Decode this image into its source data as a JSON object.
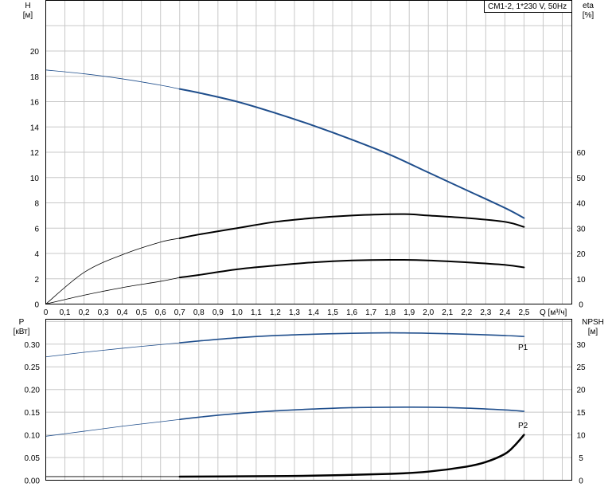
{
  "chart_data": [
    {
      "type": "line",
      "panel": "head",
      "title": "CM1-2, 1*230 V, 50Hz",
      "xlabel": "Q [м³/ч]",
      "x_ticks": [
        "0",
        "0,1",
        "0,2",
        "0,3",
        "0,4",
        "0,5",
        "0,6",
        "0,7",
        "0,8",
        "0,9",
        "1,0",
        "1,1",
        "1,2",
        "1,3",
        "1,4",
        "1,5",
        "1,6",
        "1,7",
        "1,8",
        "1,9",
        "2,0",
        "2,1",
        "2,2",
        "2,3",
        "2,4",
        "2,5"
      ],
      "xlim": [
        0,
        2.75
      ],
      "ylabel_left": "H",
      "ylabel_left_unit": "[м]",
      "ylim_left": [
        0,
        24
      ],
      "y_ticks_left": [
        "0",
        "2",
        "4",
        "6",
        "8",
        "10",
        "12",
        "14",
        "16",
        "18",
        "20"
      ],
      "ylabel_right": "eta",
      "ylabel_right_unit": "[%]",
      "ylim_right": [
        0,
        120
      ],
      "y_ticks_right": [
        "0",
        "10",
        "20",
        "30",
        "40",
        "50",
        "60"
      ],
      "grid": true,
      "series": [
        {
          "axis": "left",
          "color": "#1f4e8c",
          "operating_range": [
            0.7,
            2.5
          ],
          "x": [
            0,
            0.2,
            0.4,
            0.6,
            0.7,
            0.8,
            1.0,
            1.2,
            1.4,
            1.6,
            1.8,
            2.0,
            2.2,
            2.4,
            2.5
          ],
          "y": [
            18.5,
            18.2,
            17.8,
            17.3,
            17.0,
            16.7,
            16.0,
            15.1,
            14.1,
            13.0,
            11.8,
            10.4,
            9.0,
            7.6,
            6.8
          ]
        },
        {
          "axis": "right",
          "color": "#000000",
          "operating_range": [
            0.7,
            2.5
          ],
          "x": [
            0,
            0.2,
            0.4,
            0.6,
            0.7,
            0.8,
            1.0,
            1.2,
            1.4,
            1.6,
            1.8,
            1.9,
            2.0,
            2.2,
            2.4,
            2.5
          ],
          "y": [
            0,
            12.5,
            19.5,
            24.5,
            26.0,
            27.5,
            30.0,
            32.5,
            34.0,
            35.0,
            35.5,
            35.5,
            35.0,
            34.0,
            32.5,
            30.5
          ]
        },
        {
          "axis": "left",
          "color": "#000000",
          "operating_range": [
            0.7,
            2.5
          ],
          "x": [
            0,
            0.2,
            0.4,
            0.6,
            0.7,
            0.8,
            1.0,
            1.2,
            1.4,
            1.6,
            1.8,
            2.0,
            2.2,
            2.4,
            2.5
          ],
          "y": [
            0,
            0.7,
            1.3,
            1.8,
            2.1,
            2.3,
            2.75,
            3.05,
            3.3,
            3.45,
            3.5,
            3.45,
            3.3,
            3.1,
            2.9
          ]
        }
      ]
    },
    {
      "type": "line",
      "panel": "power",
      "ylabel_left": "P",
      "ylabel_left_unit": "[кВт]",
      "ylim_left": [
        0,
        0.355
      ],
      "y_ticks_left": [
        "0.00",
        "0.05",
        "0.10",
        "0.15",
        "0.20",
        "0.25",
        "0.30"
      ],
      "ylabel_right": "NPSH",
      "ylabel_right_unit": "[м]",
      "ylim_right": [
        0,
        35.5
      ],
      "y_ticks_right": [
        "0",
        "5",
        "10",
        "15",
        "20",
        "25",
        "30"
      ],
      "xlim": [
        0,
        2.75
      ],
      "grid": true,
      "series": [
        {
          "name": "P1",
          "axis": "left",
          "color": "#1f4e8c",
          "operating_range": [
            0.7,
            2.5
          ],
          "x": [
            0,
            0.2,
            0.4,
            0.6,
            0.7,
            0.8,
            1.0,
            1.2,
            1.4,
            1.6,
            1.8,
            2.0,
            2.2,
            2.4,
            2.5
          ],
          "y": [
            0.272,
            0.282,
            0.291,
            0.299,
            0.303,
            0.307,
            0.314,
            0.319,
            0.322,
            0.324,
            0.325,
            0.324,
            0.322,
            0.319,
            0.317
          ]
        },
        {
          "name": "P2",
          "axis": "left",
          "color": "#1f4e8c",
          "operating_range": [
            0.7,
            2.5
          ],
          "x": [
            0,
            0.2,
            0.4,
            0.6,
            0.7,
            0.8,
            1.0,
            1.2,
            1.4,
            1.6,
            1.8,
            2.0,
            2.2,
            2.4,
            2.5
          ],
          "y": [
            0.097,
            0.108,
            0.119,
            0.129,
            0.134,
            0.139,
            0.147,
            0.153,
            0.157,
            0.16,
            0.161,
            0.161,
            0.159,
            0.155,
            0.152
          ]
        },
        {
          "axis": "right",
          "color": "#000000",
          "operating_range": [
            0.7,
            2.5
          ],
          "x": [
            0,
            0.7,
            1.0,
            1.4,
            1.8,
            2.0,
            2.2,
            2.3,
            2.4,
            2.45,
            2.5
          ],
          "y": [
            0.8,
            0.8,
            0.85,
            1.0,
            1.4,
            1.9,
            3.0,
            4.0,
            5.8,
            7.6,
            10.0
          ]
        }
      ]
    }
  ],
  "colors": {
    "grid": "#c8c8c8",
    "blue": "#1f4e8c",
    "black": "#000000"
  }
}
